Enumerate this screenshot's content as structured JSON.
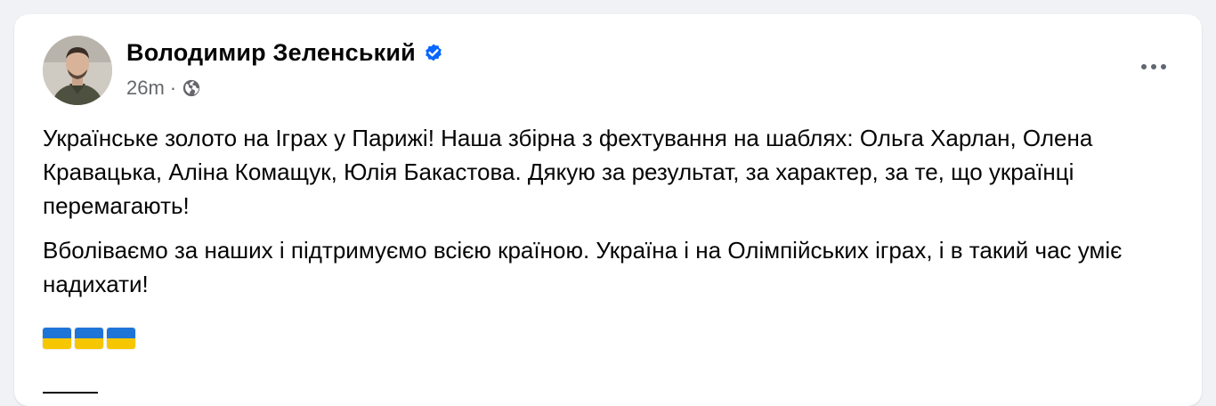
{
  "post": {
    "author_name": "Володимир Зеленський",
    "timestamp": "26m",
    "meta_separator": "·",
    "paragraphs": [
      "Українське золото на Іграх у Парижі! Наша збірна з фехтування на шаблях: Ольга Харлан, Олена Кравацька, Аліна Комащук, Юлія Бакастова. Дякую за результат, за характер, за те, що українці перемагають!",
      "Вболіваємо за наших і підтримуємо всією країною. Україна і на Олімпійських іграх, і в такий час уміє надихати!"
    ],
    "flags_count": 3,
    "icons": {
      "verified": "verified-badge-icon",
      "audience": "globe-icon",
      "menu": "more-options-icon"
    },
    "colors": {
      "verified_blue": "#0866ff",
      "flag_blue": "#1f74d8",
      "flag_yellow": "#f6c700",
      "secondary_text": "#65676b"
    }
  }
}
